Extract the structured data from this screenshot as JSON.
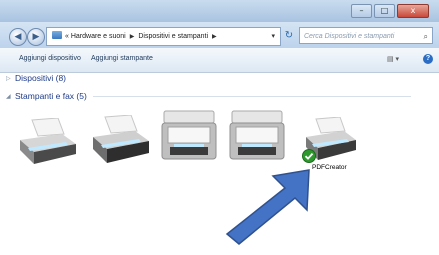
{
  "window": {
    "buttons": {
      "minimize": "–",
      "maximize": "□",
      "close": "x"
    }
  },
  "nav": {
    "back_icon": "back-arrow-icon",
    "forward_icon": "forward-arrow-icon",
    "breadcrumb": {
      "prefix": "«",
      "part1": "Hardware e suoni",
      "sep": "▶",
      "part2": "Dispositivi e stampanti"
    },
    "search_placeholder": "Cerca Dispositivi e stampanti"
  },
  "toolbar": {
    "add_device": "Aggiungi dispositivo",
    "add_printer": "Aggiungi stampante"
  },
  "groups": {
    "devices": "Dispositivi (8)",
    "printers": "Stampanti e fax (5)"
  },
  "printers": [
    {
      "name": "",
      "icon": "printer-icon"
    },
    {
      "name": "",
      "icon": "printer-icon"
    },
    {
      "name": "",
      "icon": "mfp-printer-icon"
    },
    {
      "name": "",
      "icon": "mfp-printer-icon"
    },
    {
      "name": "PDFCreator",
      "icon": "printer-icon",
      "default": true
    }
  ],
  "colors": {
    "accent": "#4472c4",
    "title": "#1e3b8a",
    "default_check": "#2e9a2e"
  }
}
